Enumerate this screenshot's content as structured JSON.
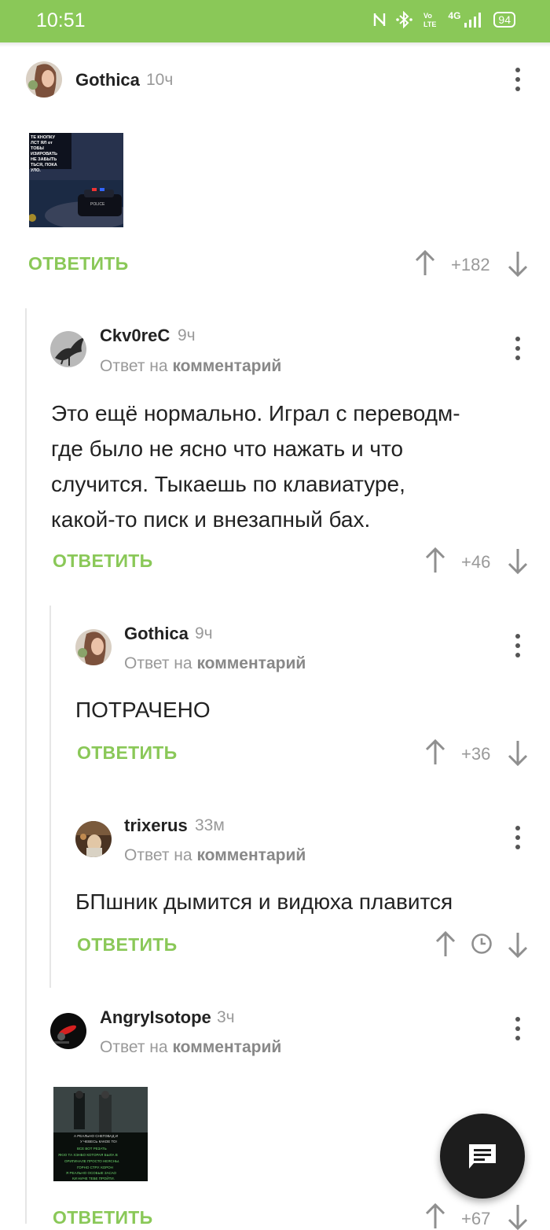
{
  "status_bar": {
    "time": "10:51",
    "battery": "94",
    "network": "4G"
  },
  "comments": [
    {
      "author": "Gothica",
      "time": "10ч",
      "reply_label": "ОТВЕТИТЬ",
      "rating": "+182"
    },
    {
      "author": "Ckv0reC",
      "time": "9ч",
      "reply_to_prefix": "Ответ на",
      "reply_to_link": "комментарий",
      "text_lines": [
        "Это ещё нормально. Играл с переводм-",
        "где было не ясно что нажать и что",
        "случится. Тыкаешь по клавиатуре,",
        "какой-то писк и внезапный бах."
      ],
      "reply_label": "ОТВЕТИТЬ",
      "rating": "+46"
    },
    {
      "author": "Gothica",
      "time": "9ч",
      "reply_to_prefix": "Ответ на",
      "reply_to_link": "комментарий",
      "text": "ПОТРАЧЕНО",
      "reply_label": "ОТВЕТИТЬ",
      "rating": "+36"
    },
    {
      "author": "trixerus",
      "time": "33м",
      "reply_to_prefix": "Ответ на",
      "reply_to_link": "комментарий",
      "text": "БПшник дымится и видюха плавится",
      "reply_label": "ОТВЕТИТЬ"
    },
    {
      "author": "AngryIsotope",
      "time": "3ч",
      "reply_to_prefix": "Ответ на",
      "reply_to_link": "комментарий",
      "reply_label": "ОТВЕТИТЬ",
      "rating": "+67"
    }
  ],
  "images": {
    "gta_overlay_lines": [
      "ТЕ КНОПКУ",
      "ЛСТ ЯЛ от",
      "ТОБЫ",
      "ИЗИРОВАТЬ",
      "НЕ ЗАБЫТЬ",
      "ТЬСЯ, ПОКА",
      "УЛО."
    ],
    "car_label": "POLICE",
    "matrix_lines": [
      "А РЕАЛЬНО СНЕГОВАД И",
      "У ЧЕВЕСЬ КАКОЕ ТО!",
      "ВСЕ ВОТ РЕЗАТЬ",
      "ЯЮО ТА ХЭНБО КОТОРАЯ БЫЛА В",
      "ОРИГИНАЛЕ ПРОСТО НЕЯСНЫ.",
      "ГОРНО СТРУ. КОРОН",
      "Я РЕАЛЬНО ОСОБЫЕ ЗАСАО",
      "КИ НИЧЕ ТЕБЕ ПРОЙТИ."
    ]
  },
  "colors": {
    "accent": "#8ac858",
    "fab": "#1d1d1d"
  },
  "icons": [
    "upvote-arrow-icon",
    "downvote-arrow-icon",
    "kebab-menu-icon",
    "clock-icon",
    "comment-icon"
  ]
}
